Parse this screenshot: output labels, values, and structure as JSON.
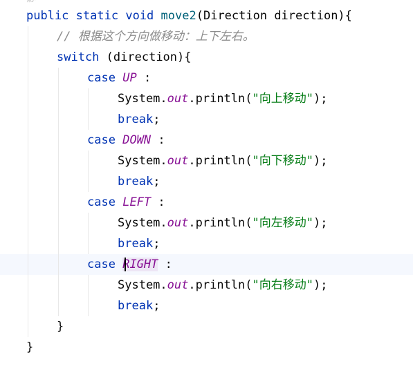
{
  "editor": {
    "cut_off_top": "静",
    "method": {
      "kw_public": "public",
      "kw_static": "static",
      "kw_void": "void",
      "name": "move2",
      "params": "(Direction direction){"
    },
    "comment": "// 根据这个方向做移动：上下左右。",
    "switch": {
      "kw": "switch",
      "expr": "(direction){"
    },
    "cases": [
      {
        "kw": "case",
        "label": "UP",
        "colon": ":",
        "sys": "System.",
        "out": "out",
        "call": ".println(",
        "message": "\"向上移动\"",
        "end": ");",
        "break_kw": "break",
        "semi": ";"
      },
      {
        "kw": "case",
        "label": "DOWN",
        "colon": ":",
        "sys": "System.",
        "out": "out",
        "call": ".println(",
        "message": "\"向下移动\"",
        "end": ");",
        "break_kw": "break",
        "semi": ";"
      },
      {
        "kw": "case",
        "label": "LEFT",
        "colon": ":",
        "sys": "System.",
        "out": "out",
        "call": ".println(",
        "message": "\"向左移动\"",
        "end": ");",
        "break_kw": "break",
        "semi": ";"
      },
      {
        "kw": "case",
        "label": "RIGHT",
        "colon": ":",
        "sys": "System.",
        "out": "out",
        "call": ".println(",
        "message": "\"向右移动\"",
        "end": ");",
        "break_kw": "break",
        "semi": ";"
      }
    ],
    "close_switch": "}",
    "close_method": "}",
    "colors": {
      "keyword": "#0033b3",
      "method": "#00627a",
      "comment": "#8c8c8c",
      "enum_constant": "#871094",
      "string": "#067d17",
      "current_line": "#f5f8fe"
    }
  }
}
